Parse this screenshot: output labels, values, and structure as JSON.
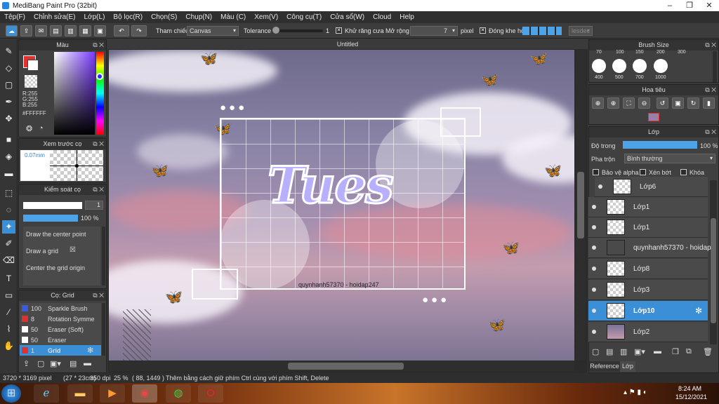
{
  "window": {
    "title": "MediBang Paint Pro (32bit)",
    "minimize": "–",
    "maximize": "❐",
    "close": "✕"
  },
  "menu": [
    "Tệp(F)",
    "Chỉnh sửa(E)",
    "Lớp(L)",
    "Bộ lọc(R)",
    "Chọn(S)",
    "Chụp(N)",
    "Màu (C)",
    "Xem(V)",
    "Công cụ(T)",
    "Cửa sổ(W)",
    "Cloud",
    "Help"
  ],
  "toolbar": {
    "reference_label": "Tham chiếu",
    "reference_value": "Canvas",
    "tolerance_label": "Tolerance",
    "tolerance_value": "1",
    "antialias_label": "Khử răng cưa",
    "expand_label": "Mở rộng",
    "expand_value": "7",
    "expand_unit": "pixel",
    "close_gap_label": "Đóng khe hở",
    "extra": "lesdec"
  },
  "color_panel": {
    "title": "Màu",
    "r": "R:255",
    "g": "G:255",
    "b": "B:255",
    "hex": "#FFFFFF"
  },
  "preview_panel": {
    "title": "Xem trước cọ",
    "size": "0.07mm"
  },
  "brush_control": {
    "title": "Kiểm soát cọ",
    "size_value": "1",
    "opacity_value": "100 %",
    "options": [
      "Draw the center point",
      "Draw a grid",
      "Center the grid origin"
    ],
    "draw_grid_check": "☒"
  },
  "brush_list": {
    "title": "Cọ: Grid",
    "items": [
      {
        "size": "100",
        "name": "Sparkle Brush",
        "color": "#3b5bdb"
      },
      {
        "size": "8",
        "name": "Rotation Symme",
        "color": "#e03131"
      },
      {
        "size": "50",
        "name": "Eraser (Soft)",
        "color": "#ffffff"
      },
      {
        "size": "50",
        "name": "Eraser",
        "color": "#ffffff"
      },
      {
        "size": "1",
        "name": "Grid",
        "color": "#e03131"
      }
    ]
  },
  "document": {
    "tab": "Untitled",
    "art_text": "Tues",
    "watermark": "quynhanh57370 - hoidap247"
  },
  "brush_size_panel": {
    "title": "Brush Size",
    "top_values": [
      "70",
      "100",
      "150",
      "200",
      "300"
    ],
    "values": [
      "400",
      "500",
      "700",
      "1000"
    ]
  },
  "navigator_panel": {
    "title": "Hoa tiêu"
  },
  "layer_panel": {
    "title": "Lớp",
    "opacity_label": "Độ trong",
    "opacity_value": "100 %",
    "blend_label": "Pha trộn",
    "blend_value": "Bình thường",
    "protect_alpha": "Bảo vệ alpha",
    "clipping": "Xén bớt",
    "lock": "Khóa",
    "layers": [
      {
        "name": "Lớp6",
        "selected": false
      },
      {
        "name": "Lớp1",
        "selected": false
      },
      {
        "name": "Lớp1",
        "selected": false
      },
      {
        "name": "quynhanh57370 - hoidap",
        "selected": false
      },
      {
        "name": "Lớp8",
        "selected": false
      },
      {
        "name": "Lớp3",
        "selected": false
      },
      {
        "name": "Lớp10",
        "selected": true
      },
      {
        "name": "Lớp2",
        "selected": false
      }
    ],
    "tabs": [
      "Reference",
      "Lớp"
    ]
  },
  "status": {
    "size": "3720 * 3169 pixel",
    "physical": "(27 * 23cm)",
    "dpi": "350 dpi",
    "zoom": "25 %",
    "coords": "( 88, 1449 )",
    "hint": "Thêm bằng cách giữ phím Ctrl cùng với phím Shift, Delete"
  },
  "taskbar": {
    "time": "8:24 AM",
    "date": "15/12/2021"
  }
}
